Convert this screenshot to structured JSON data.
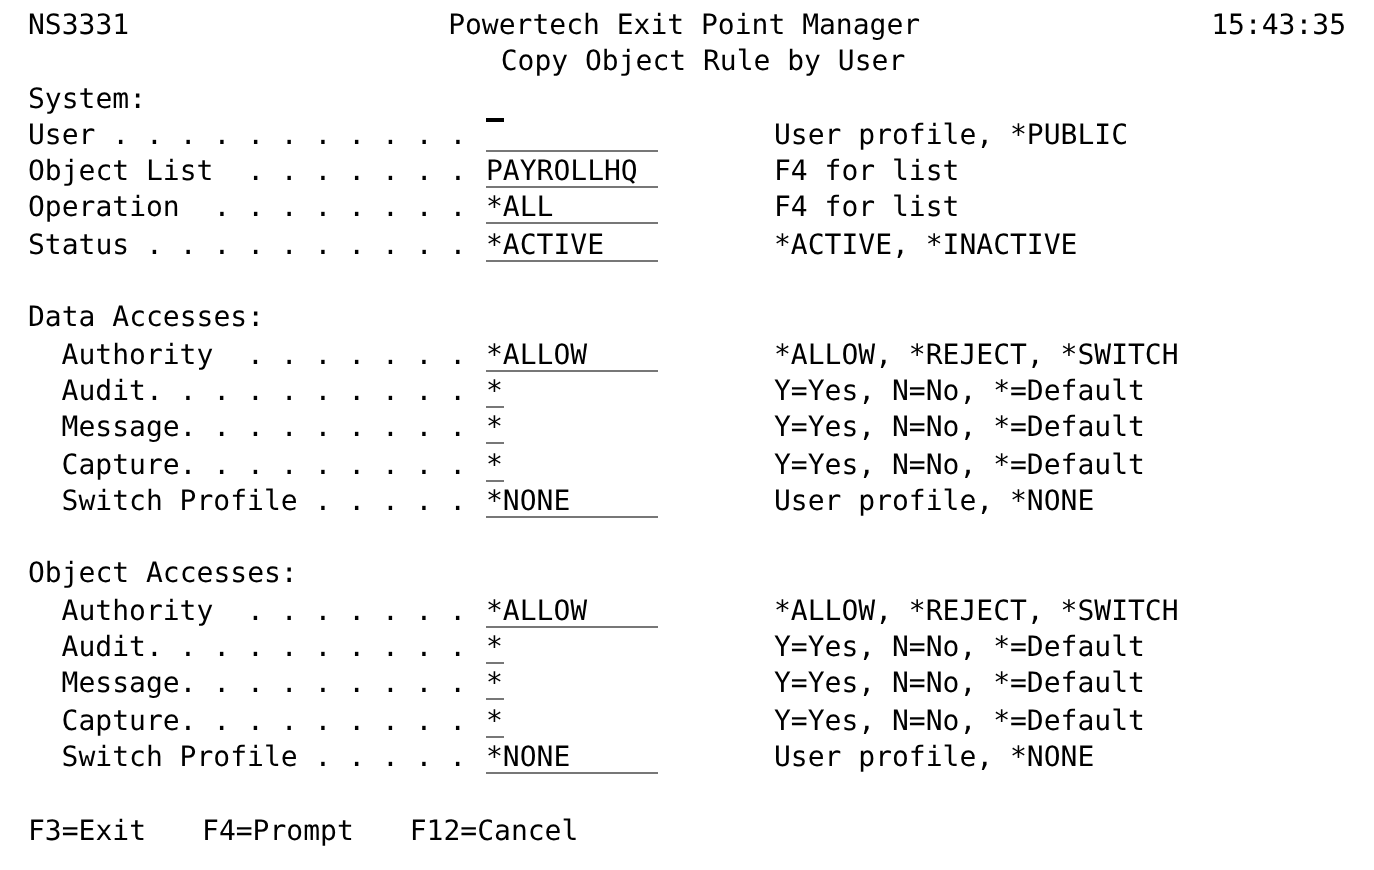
{
  "header": {
    "screen_id": "NS3331",
    "title": "Powertech Exit Point Manager",
    "subtitle": "Copy Object Rule by User",
    "time": "15:43:35"
  },
  "sections": [
    {
      "heading": "System:",
      "indented": false,
      "fields": [
        {
          "label": "User . . . . . . . . . . .",
          "kind": "text",
          "focused": true,
          "help": "User profile, *PUBLIC"
        },
        {
          "label": "Object List  . . . . . . .",
          "kind": "text",
          "focused": false,
          "value": "PAYROLLHQ",
          "help": "F4 for list"
        },
        {
          "label": "Operation  . . . . . . . .",
          "kind": "text",
          "focused": false,
          "value": "*ALL",
          "help": "F4 for list"
        },
        {
          "label": "Status . . . . . . . . . .",
          "kind": "text",
          "focused": false,
          "value": "*ACTIVE",
          "help": "*ACTIVE, *INACTIVE"
        }
      ]
    },
    {
      "heading": "Data Accesses:",
      "indented": true,
      "fields": [
        {
          "label": "Authority  . . . . . . .",
          "kind": "text",
          "focused": false,
          "value": "*ALLOW",
          "help": "*ALLOW, *REJECT, *SWITCH"
        },
        {
          "label": "Audit. . . . . . . . . .",
          "kind": "flag",
          "focused": false,
          "value": "*",
          "help": "Y=Yes, N=No, *=Default"
        },
        {
          "label": "Message. . . . . . . . .",
          "kind": "flag",
          "focused": false,
          "value": "*",
          "help": "Y=Yes, N=No, *=Default"
        },
        {
          "label": "Capture. . . . . . . . .",
          "kind": "flag",
          "focused": false,
          "value": "*",
          "help": "Y=Yes, N=No, *=Default"
        },
        {
          "label": "Switch Profile . . . . .",
          "kind": "text",
          "focused": false,
          "value": "*NONE",
          "help": "User profile, *NONE"
        }
      ]
    },
    {
      "heading": "Object Accesses:",
      "indented": true,
      "fields": [
        {
          "label": "Authority  . . . . . . .",
          "kind": "text",
          "focused": false,
          "value": "*ALLOW",
          "help": "*ALLOW, *REJECT, *SWITCH"
        },
        {
          "label": "Audit. . . . . . . . . .",
          "kind": "flag",
          "focused": false,
          "value": "*",
          "help": "Y=Yes, N=No, *=Default"
        },
        {
          "label": "Message. . . . . . . . .",
          "kind": "flag",
          "focused": false,
          "value": "*",
          "help": "Y=Yes, N=No, *=Default"
        },
        {
          "label": "Capture. . . . . . . . .",
          "kind": "flag",
          "focused": false,
          "value": "*",
          "help": "Y=Yes, N=No, *=Default"
        },
        {
          "label": "Switch Profile . . . . .",
          "kind": "text",
          "focused": false,
          "value": "*NONE",
          "help": "User profile, *NONE"
        }
      ]
    }
  ],
  "function_keys": [
    "F3=Exit",
    "F4=Prompt",
    "F12=Cancel"
  ]
}
